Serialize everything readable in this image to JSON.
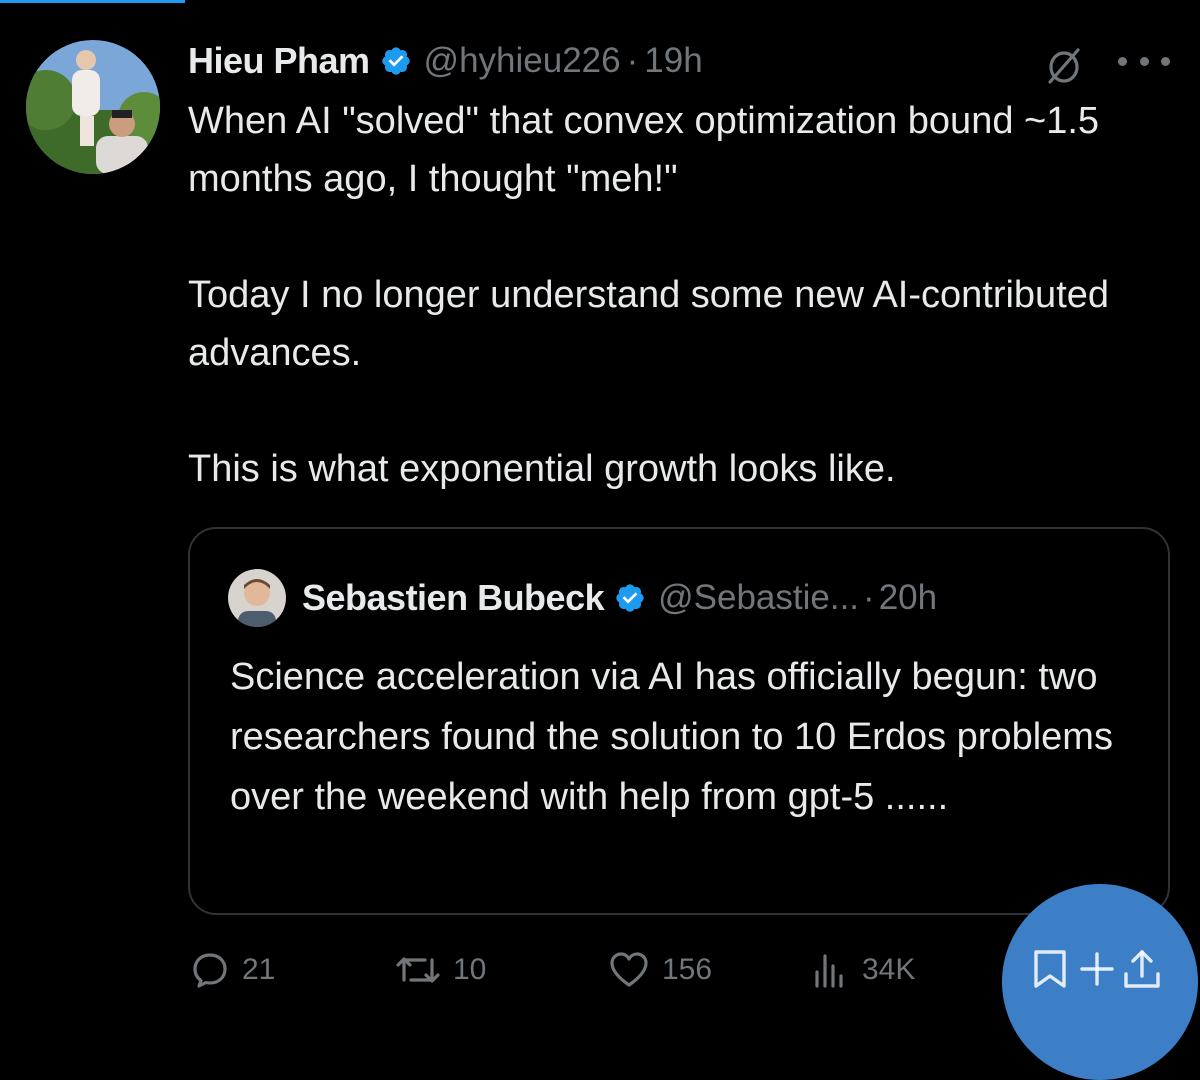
{
  "tweet": {
    "author": {
      "name": "Hieu Pham",
      "handle": "@hyhieu226",
      "separator": "·",
      "time": "19h"
    },
    "paragraphs": [
      "When AI \"solved\" that convex optimization bound ~1.5 months ago, I thought \"meh!\"",
      "Today I no longer understand some new AI-contributed advances.",
      "This is what exponential growth looks like."
    ],
    "quoted": {
      "name": "Sebastien Bubeck",
      "handle": "@Sebastie...",
      "separator": "·",
      "time": "20h",
      "text": "Science acceleration via AI has officially begun: two researchers found the solution to 10 Erdos problems over the weekend with help from gpt-5 ......"
    },
    "actions": {
      "replies": "21",
      "reposts": "10",
      "likes": "156",
      "views": "34K"
    }
  },
  "colors": {
    "background": "#000000",
    "text": "#e7e9ea",
    "muted": "#71767b",
    "verified": "#1d9bf0",
    "border": "#2f3336",
    "fab": "#3c7fc7"
  },
  "icons": [
    "verified-badge-icon",
    "grok-icon",
    "more-icon",
    "reply-icon",
    "repost-icon",
    "like-icon",
    "views-icon",
    "bookmark-add-icon",
    "share-icon"
  ]
}
